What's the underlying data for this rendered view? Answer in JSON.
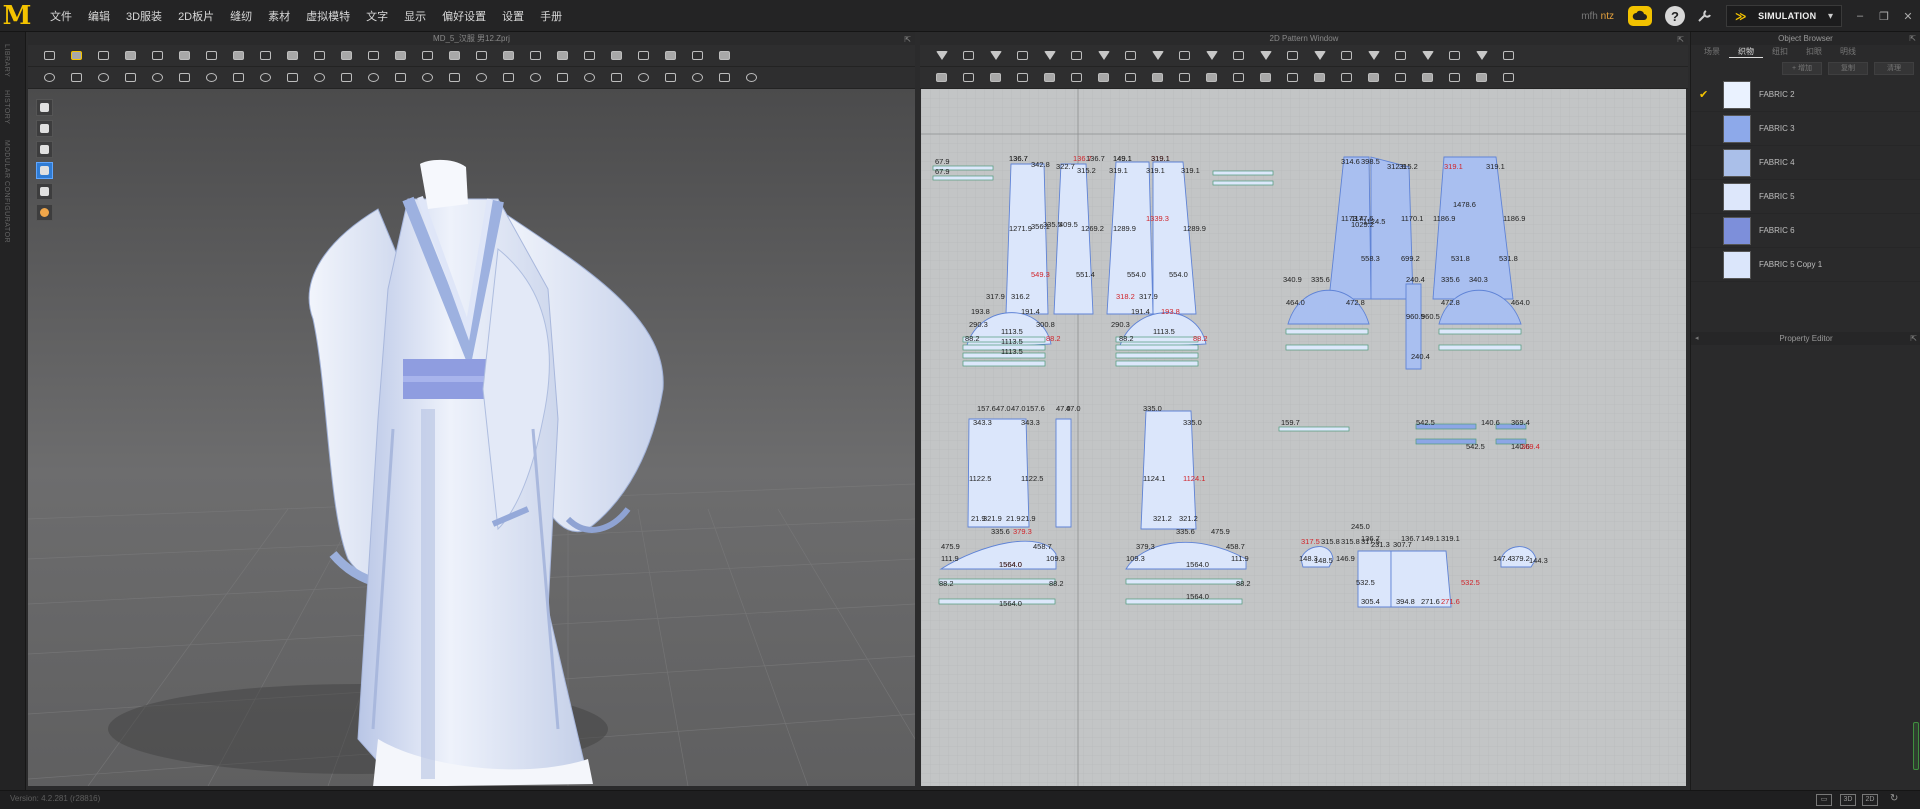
{
  "app": {
    "logo": "M"
  },
  "menu": [
    "文件",
    "编辑",
    "3D服装",
    "2D板片",
    "缝纫",
    "素材",
    "虚拟模特",
    "文字",
    "显示",
    "偏好设置",
    "设置",
    "手册"
  ],
  "topright": {
    "user_prefix": "mfh",
    "user_name": "ntz",
    "help_icon": "?",
    "simulation_label": "SIMULATION",
    "chevron": "▾",
    "minimize": "–",
    "restore": "❐",
    "close": "✕"
  },
  "left_strip": {
    "tabs": [
      "LIBRARY",
      "HISTORY",
      "MODULAR CONFIGURATOR"
    ]
  },
  "window3d": {
    "title": "MD_5_汉服 男12.Zprj",
    "popout": "⇱"
  },
  "window2d": {
    "title": "2D Pattern Window",
    "popout": "⇱"
  },
  "object_browser": {
    "title": "Object Browser",
    "popout": "⇱",
    "tabs": [
      "场景",
      "织物",
      "纽扣",
      "扣眼",
      "明线"
    ],
    "active_tab": 1,
    "buttons": [
      "+ 增加",
      "复制",
      "清理"
    ],
    "fabrics": [
      {
        "name": "FABRIC 2",
        "color": "#eaf2ff",
        "checked": true
      },
      {
        "name": "FABRIC 3",
        "color": "#8da9ea",
        "checked": false
      },
      {
        "name": "FABRIC 4",
        "color": "#aabfe9",
        "checked": false
      },
      {
        "name": "FABRIC 5",
        "color": "#dde7fb",
        "checked": false
      },
      {
        "name": "FABRIC 6",
        "color": "#7d8fda",
        "checked": false
      },
      {
        "name": "FABRIC 5 Copy 1",
        "color": "#dbe6fb",
        "checked": false
      }
    ],
    "check_mark": "✔"
  },
  "property_editor": {
    "title": "Property Editor",
    "collapse": "◂",
    "popout": "⇱"
  },
  "status": {
    "version": "Version: 4.2.281 (r28816)"
  },
  "pattern_labels": [
    "67.9",
    "136.7",
    "342.8",
    "136.7",
    "149.1",
    "319.1",
    "67.9",
    "136.7",
    "136.7",
    "149.1",
    "319.1",
    "322.7",
    "315.2",
    "319.1",
    "319.1",
    "319.1",
    "314.6",
    "398.5",
    "312.9",
    "315.2",
    "319.1",
    "319.1",
    "1271.9",
    "356.1",
    "335.5",
    "409.5",
    "1269.2",
    "1289.9",
    "1339.3",
    "1289.9",
    "1173.4",
    "1177.6",
    "1124.5",
    "1170.1",
    "1186.9",
    "1478.6",
    "1186.9",
    "549.3",
    "551.4",
    "554.0",
    "554.0",
    "558.3",
    "699.2",
    "531.8",
    "531.8",
    "317.9",
    "316.2",
    "193.8",
    "191.4",
    "290.3",
    "300.8",
    "318.2",
    "317.9",
    "191.4",
    "193.8",
    "290.3",
    "340.9",
    "335.6",
    "464.0",
    "472.8",
    "335.6",
    "340.3",
    "472.8",
    "464.0",
    "240.4",
    "960.5",
    "960.5",
    "88.2",
    "1113.5",
    "1113.5",
    "1113.5",
    "88.2",
    "88.2",
    "1113.5",
    "88.2",
    "157.6",
    "47.0",
    "47.0",
    "157.6",
    "47.0",
    "47.0",
    "343.3",
    "343.3",
    "335.0",
    "335.0",
    "1122.5",
    "1122.5",
    "1124.1",
    "1124.1",
    "21.9",
    "321.9",
    "21.9",
    "21.9",
    "321.2",
    "321.2",
    "475.9",
    "335.6",
    "379.3",
    "458.7",
    "379.3",
    "335.6",
    "475.9",
    "458.7",
    "111.9",
    "109.3",
    "1564.0",
    "109.3",
    "111.9",
    "1564.0",
    "88.2",
    "1564.0",
    "88.2",
    "1564.0",
    "1564.0",
    "88.2",
    "159.7",
    "542.5",
    "140.6",
    "369.4",
    "140.6",
    "369.4",
    "542.5",
    "317.5",
    "315.8",
    "315.8",
    "317.5",
    "148.3",
    "148.5",
    "146.9",
    "147.4",
    "379.2",
    "144.3",
    "136.7",
    "231.3",
    "307.7",
    "136.7",
    "149.1",
    "319.1",
    "532.5",
    "532.5",
    "305.4",
    "394.8",
    "271.6",
    "271.6",
    "245.0",
    "1029.2",
    "240.4"
  ]
}
